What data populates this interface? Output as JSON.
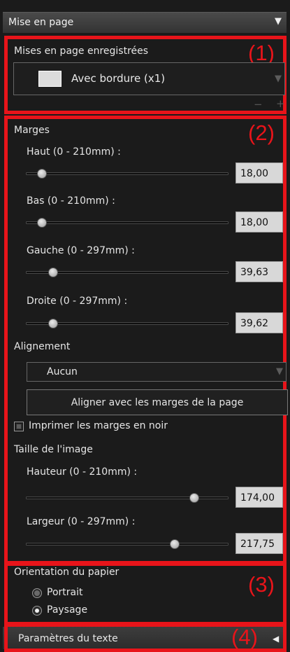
{
  "header": {
    "title": "Mise en page"
  },
  "section1": {
    "number": "(1)",
    "label": "Mises en page enregistrées",
    "selected_layout": "Avec bordure (x1)",
    "remove_symbol": "−",
    "add_symbol": "+"
  },
  "section2": {
    "number": "(2)",
    "margins_label": "Marges",
    "margins": [
      {
        "label": "Haut (0 - 210mm) :",
        "value": "18,00",
        "fraction": 0.08
      },
      {
        "label": "Bas (0 - 210mm) :",
        "value": "18,00",
        "fraction": 0.08
      },
      {
        "label": "Gauche (0 - 297mm) :",
        "value": "39,63",
        "fraction": 0.135
      },
      {
        "label": "Droite (0 - 297mm) :",
        "value": "39,62",
        "fraction": 0.135
      }
    ],
    "alignment_label": "Alignement",
    "alignment_value": "Aucun",
    "align_button": "Aligner avec les marges de la page",
    "print_black_margins": "Imprimer les marges en noir",
    "image_size_label": "Taille de l'image",
    "image_size": [
      {
        "label": "Hauteur (0 - 210mm) :",
        "value": "174,00",
        "fraction": 0.83
      },
      {
        "label": "Largeur (0 - 297mm) :",
        "value": "217,75",
        "fraction": 0.733
      }
    ]
  },
  "section3": {
    "number": "(3)",
    "label": "Orientation du papier",
    "options": [
      "Portrait",
      "Paysage"
    ],
    "selected": "Paysage"
  },
  "section4": {
    "number": "(4)",
    "label": "Paramètres du texte"
  },
  "colors": {
    "highlight": "#e8141a",
    "panel": "#1b1b1b",
    "value_box": "#d8d8d8"
  },
  "icons": {
    "collapse": "triangle-down-icon",
    "expand": "triangle-left-icon"
  }
}
